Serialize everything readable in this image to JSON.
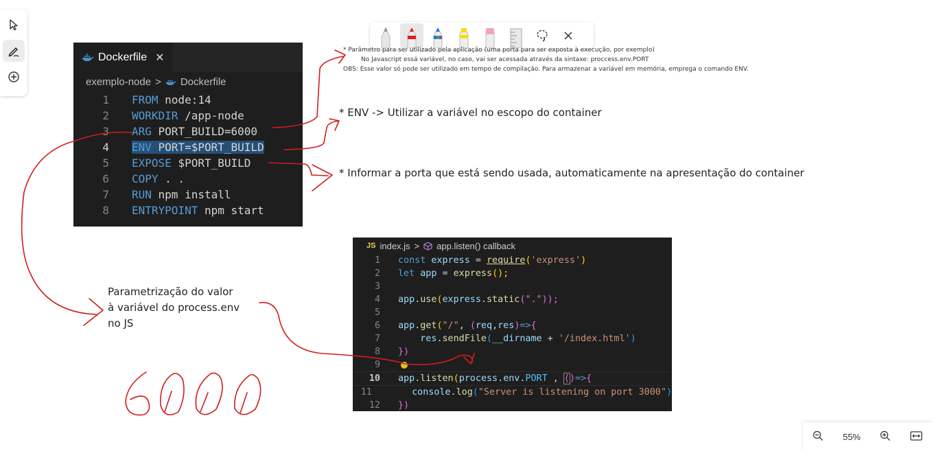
{
  "toolbar": {
    "tools": [
      "select-tool",
      "draw-tool",
      "add-tool"
    ],
    "pens": [
      "pencil",
      "red-pen",
      "multicolor-pen",
      "yellow-highlighter",
      "pink-eraser",
      "ruler"
    ],
    "pen_colors": [
      "#cfcfcf",
      "#e02020",
      "#2a6fd6",
      "#f4e000",
      "#f4a3b4",
      "#d0d0d0"
    ]
  },
  "dockerfile": {
    "tab_label": "Dockerfile",
    "close_glyph": "✕",
    "breadcrumb_folder": "exemplo-node",
    "breadcrumb_sep": ">",
    "breadcrumb_file": "Dockerfile",
    "lines": [
      {
        "num": "1",
        "kw": "FROM",
        "rest": " node:14"
      },
      {
        "num": "2",
        "kw": "WORKDIR",
        "rest": " /app-node"
      },
      {
        "num": "3",
        "kw": "ARG",
        "rest": " PORT_BUILD=6000"
      },
      {
        "num": "4",
        "kw": "ENV",
        "rest": " PORT=$PORT_BUILD"
      },
      {
        "num": "5",
        "kw": "EXPOSE",
        "rest": " $PORT_BUILD"
      },
      {
        "num": "6",
        "kw": "COPY",
        "rest": " . ."
      },
      {
        "num": "7",
        "kw": "RUN",
        "rest": " npm install"
      },
      {
        "num": "8",
        "kw": "ENTRYPOINT",
        "rest": " npm start"
      }
    ]
  },
  "jsfile": {
    "lang_badge": "JS",
    "breadcrumb_file": "index.js",
    "breadcrumb_sep": ">",
    "breadcrumb_symbol": "app.listen() callback",
    "line_numbers": [
      "1",
      "2",
      "3",
      "4",
      "5",
      "6",
      "7",
      "8",
      "9",
      "10",
      "11",
      "12"
    ],
    "code": {
      "l1": [
        "const",
        " express",
        " = ",
        "require",
        "(",
        "'express'",
        ")"
      ],
      "l2": [
        "let",
        " app",
        " = ",
        "express",
        "();"
      ],
      "l4": [
        "app",
        ".",
        "use",
        "(",
        "express",
        ".",
        "static",
        "(",
        "\".\"",
        "));"
      ],
      "l6": [
        "app",
        ".",
        "get",
        "(",
        "\"/\"",
        ", ",
        "(",
        "req",
        ",",
        "res",
        ")",
        "=>",
        "{"
      ],
      "l7": [
        "    res",
        ".",
        "sendFile",
        "(",
        "__dirname",
        " + ",
        "'/index.html'",
        ")"
      ],
      "l8": [
        "})"
      ],
      "l10": [
        "app",
        ".",
        "listen",
        "(",
        "process",
        ".",
        "env",
        ".",
        "PORT",
        " , ",
        "(",
        ")",
        "=>",
        "{"
      ],
      "l11": [
        "    console",
        ".",
        "log",
        "(",
        "\"Server is listening on port 3000\"",
        ")"
      ],
      "l12": [
        "})"
      ]
    }
  },
  "annotations": {
    "arg_note_line1": "* Parâmetro para ser utilizado pela aplicação (uma porta para ser exposta à execução, por exemplo)",
    "arg_note_line2": "No Javascript essá variável, no caso, vai ser acessada através da sintaxe: proccess.env.PORT",
    "arg_note_line3": "OBS: Esse valor só pode ser utilizado em tempo de compilação. Para armazenar a variável em memória, emprega o comando ENV.",
    "env_note": "* ENV -> Utilizar a variável no escopo do container",
    "expose_note": "* Informar a porta que está sendo usada, automaticamente na apresentação do container",
    "param_note_line1": "Parametrização do valor",
    "param_note_line2": "à variável do process.env",
    "param_note_line3": "no JS",
    "handwritten_number": "6000"
  },
  "zoom": {
    "level": "55%",
    "zoom_out": "zoom-out",
    "zoom_in": "zoom-in",
    "fit": "fit-width"
  }
}
